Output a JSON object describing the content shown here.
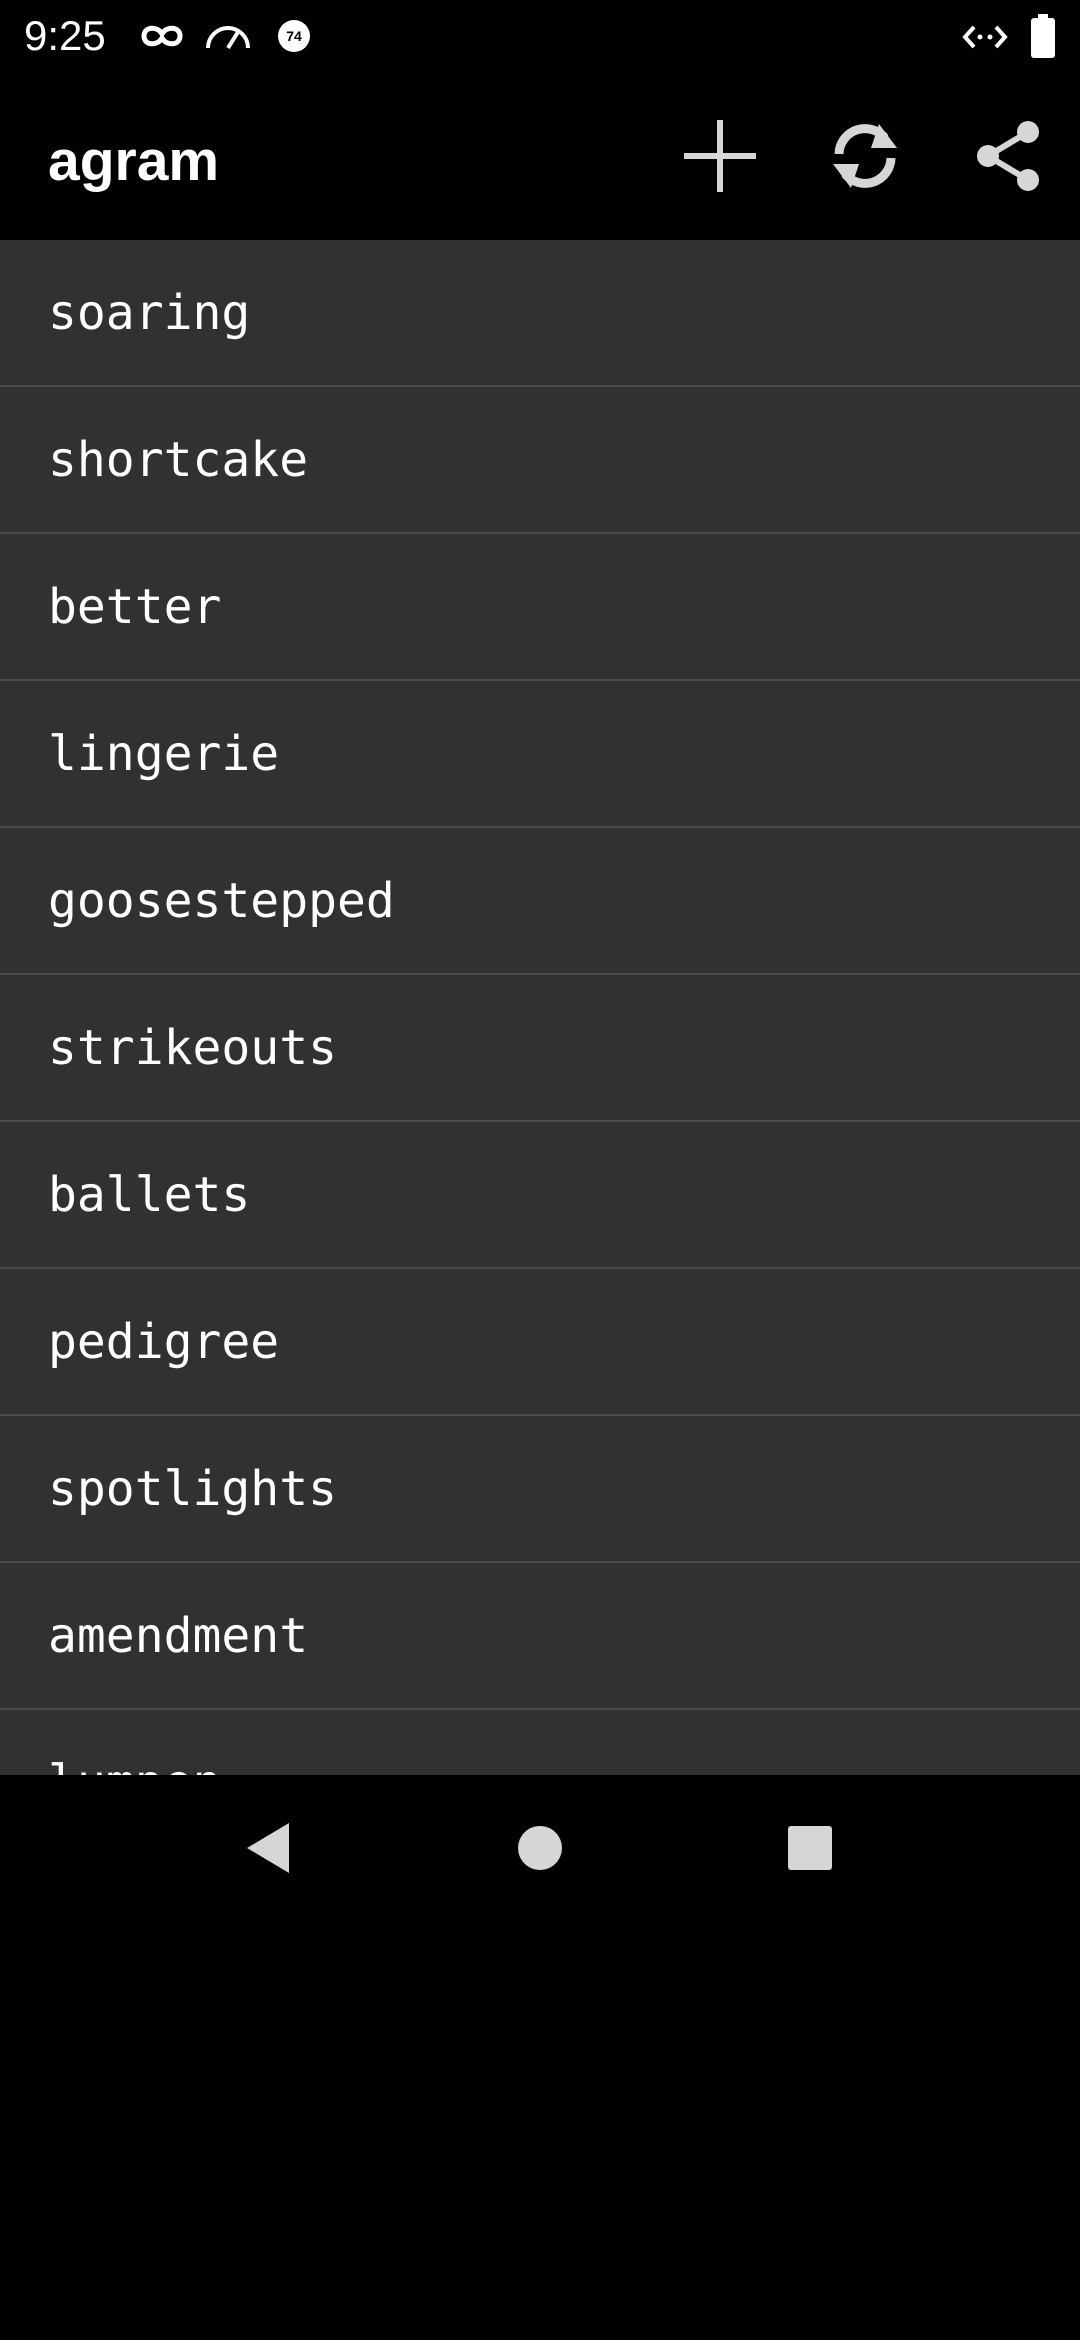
{
  "status_bar": {
    "time": "9:25",
    "left_icons": [
      "incognito-icon",
      "speedometer-icon",
      "badge-icon"
    ],
    "badge_number": "74",
    "right_icons": [
      "code-icon",
      "battery-icon"
    ]
  },
  "app_bar": {
    "title": "agram",
    "actions": [
      {
        "name": "add",
        "icon": "plus-icon"
      },
      {
        "name": "refresh",
        "icon": "refresh-icon"
      },
      {
        "name": "share",
        "icon": "share-icon"
      }
    ]
  },
  "list": {
    "items": [
      "soaring",
      "shortcake",
      "better",
      "lingerie",
      "goosestepped",
      "strikeouts",
      "ballets",
      "pedigree",
      "spotlights",
      "amendment",
      "lumpen"
    ]
  },
  "nav_bar": {
    "buttons": [
      {
        "name": "back",
        "icon": "back-triangle-icon"
      },
      {
        "name": "home",
        "icon": "home-circle-icon"
      },
      {
        "name": "recents",
        "icon": "recents-square-icon"
      }
    ]
  },
  "colors": {
    "background": "#000000",
    "list_background": "#313131",
    "divider": "#4a4a4a",
    "text": "#ffffff",
    "icon_gray": "#d6d6d6"
  }
}
